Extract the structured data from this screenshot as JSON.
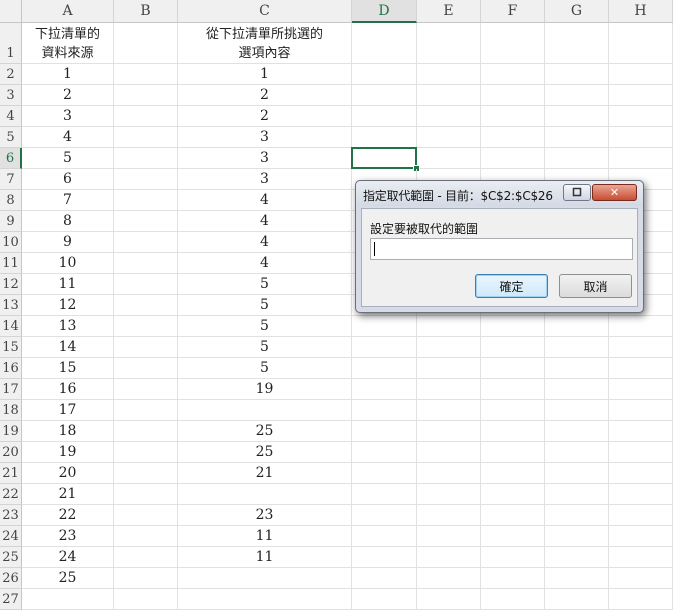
{
  "columns": [
    "A",
    "B",
    "C",
    "D",
    "E",
    "F",
    "G",
    "H"
  ],
  "active_column": "D",
  "active_row": "6",
  "header_row": {
    "A": "下拉清單的\n資料來源",
    "C": "從下拉清單所挑選的\n選項內容"
  },
  "rows": [
    {
      "num": "2",
      "A": "1",
      "C": "1"
    },
    {
      "num": "3",
      "A": "2",
      "C": "2"
    },
    {
      "num": "4",
      "A": "3",
      "C": "2"
    },
    {
      "num": "5",
      "A": "4",
      "C": "3"
    },
    {
      "num": "6",
      "A": "5",
      "C": "3"
    },
    {
      "num": "7",
      "A": "6",
      "C": "3"
    },
    {
      "num": "8",
      "A": "7",
      "C": "4"
    },
    {
      "num": "9",
      "A": "8",
      "C": "4"
    },
    {
      "num": "10",
      "A": "9",
      "C": "4"
    },
    {
      "num": "11",
      "A": "10",
      "C": "4"
    },
    {
      "num": "12",
      "A": "11",
      "C": "5"
    },
    {
      "num": "13",
      "A": "12",
      "C": "5"
    },
    {
      "num": "14",
      "A": "13",
      "C": "5"
    },
    {
      "num": "15",
      "A": "14",
      "C": "5"
    },
    {
      "num": "16",
      "A": "15",
      "C": "5"
    },
    {
      "num": "17",
      "A": "16",
      "C": "19"
    },
    {
      "num": "18",
      "A": "17",
      "C": ""
    },
    {
      "num": "19",
      "A": "18",
      "C": "25"
    },
    {
      "num": "20",
      "A": "19",
      "C": "25"
    },
    {
      "num": "21",
      "A": "20",
      "C": "21"
    },
    {
      "num": "22",
      "A": "21",
      "C": ""
    },
    {
      "num": "23",
      "A": "22",
      "C": "23"
    },
    {
      "num": "24",
      "A": "23",
      "C": "11"
    },
    {
      "num": "25",
      "A": "24",
      "C": "11"
    },
    {
      "num": "26",
      "A": "25",
      "C": ""
    },
    {
      "num": "27",
      "A": "",
      "C": ""
    }
  ],
  "dialog": {
    "title": "指定取代範圍 - 目前：$C$2:$C$26",
    "prompt": "設定要被取代的範圍",
    "input_value": "",
    "ok_label": "確定",
    "cancel_label": "取消",
    "restore_icon": "restore-icon",
    "close_icon": "close-icon"
  },
  "colors": {
    "accent": "#217346",
    "close_button": "#c74d32"
  }
}
